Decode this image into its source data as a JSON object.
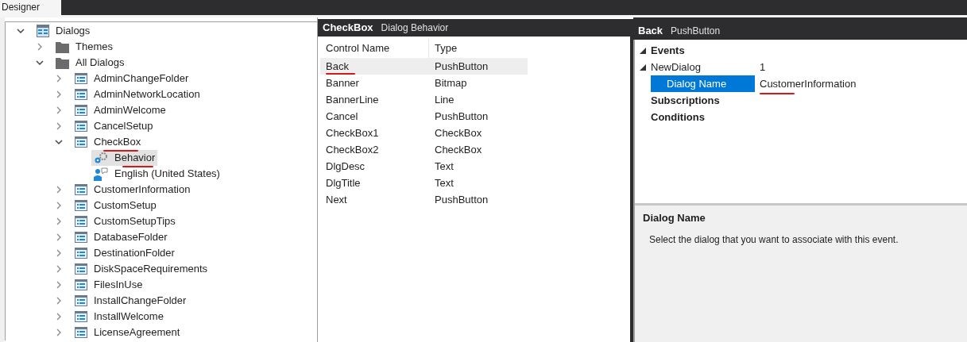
{
  "tabs": [
    {
      "label": "Designer",
      "selected": true
    }
  ],
  "tree": [
    {
      "label": "Dialogs",
      "kind": "dialogs",
      "expanded": true,
      "selected": false,
      "underlined": false,
      "children": [
        {
          "label": "Themes",
          "kind": "folder",
          "expanded": false,
          "selected": false,
          "underlined": false
        },
        {
          "label": "All Dialogs",
          "kind": "folder",
          "expanded": true,
          "selected": false,
          "underlined": false,
          "children": [
            {
              "label": "AdminChangeFolder",
              "kind": "dialog",
              "expanded": false,
              "selected": false,
              "underlined": false
            },
            {
              "label": "AdminNetworkLocation",
              "kind": "dialog",
              "expanded": false,
              "selected": false,
              "underlined": false
            },
            {
              "label": "AdminWelcome",
              "kind": "dialog",
              "expanded": false,
              "selected": false,
              "underlined": false
            },
            {
              "label": "CancelSetup",
              "kind": "dialog",
              "expanded": false,
              "selected": false,
              "underlined": false
            },
            {
              "label": "CheckBox",
              "kind": "dialog",
              "expanded": true,
              "selected": false,
              "underlined": true,
              "children": [
                {
                  "label": "Behavior",
                  "kind": "behavior",
                  "selected": true,
                  "underlined": true
                },
                {
                  "label": "English (United States)",
                  "kind": "language",
                  "selected": false,
                  "underlined": false
                }
              ]
            },
            {
              "label": "CustomerInformation",
              "kind": "dialog",
              "expanded": false,
              "selected": false,
              "underlined": false
            },
            {
              "label": "CustomSetup",
              "kind": "dialog",
              "expanded": false,
              "selected": false,
              "underlined": false
            },
            {
              "label": "CustomSetupTips",
              "kind": "dialog",
              "expanded": false,
              "selected": false,
              "underlined": false
            },
            {
              "label": "DatabaseFolder",
              "kind": "dialog",
              "expanded": false,
              "selected": false,
              "underlined": false
            },
            {
              "label": "DestinationFolder",
              "kind": "dialog",
              "expanded": false,
              "selected": false,
              "underlined": false
            },
            {
              "label": "DiskSpaceRequirements",
              "kind": "dialog",
              "expanded": false,
              "selected": false,
              "underlined": false
            },
            {
              "label": "FilesInUse",
              "kind": "dialog",
              "expanded": false,
              "selected": false,
              "underlined": false
            },
            {
              "label": "InstallChangeFolder",
              "kind": "dialog",
              "expanded": false,
              "selected": false,
              "underlined": false
            },
            {
              "label": "InstallWelcome",
              "kind": "dialog",
              "expanded": false,
              "selected": false,
              "underlined": false
            },
            {
              "label": "LicenseAgreement",
              "kind": "dialog",
              "expanded": false,
              "selected": false,
              "underlined": false
            }
          ]
        }
      ]
    }
  ],
  "controls_panel": {
    "title": "CheckBox",
    "subtitle": "Dialog Behavior",
    "columns": [
      "Control Name",
      "Type"
    ],
    "rows": [
      {
        "name": "Back",
        "type": "PushButton",
        "selected": true,
        "underlined": true
      },
      {
        "name": "Banner",
        "type": "Bitmap",
        "selected": false,
        "underlined": false
      },
      {
        "name": "BannerLine",
        "type": "Line",
        "selected": false,
        "underlined": false
      },
      {
        "name": "Cancel",
        "type": "PushButton",
        "selected": false,
        "underlined": false
      },
      {
        "name": "CheckBox1",
        "type": "CheckBox",
        "selected": false,
        "underlined": false
      },
      {
        "name": "CheckBox2",
        "type": "CheckBox",
        "selected": false,
        "underlined": false
      },
      {
        "name": "DlgDesc",
        "type": "Text",
        "selected": false,
        "underlined": false
      },
      {
        "name": "DlgTitle",
        "type": "Text",
        "selected": false,
        "underlined": false
      },
      {
        "name": "Next",
        "type": "PushButton",
        "selected": false,
        "underlined": false
      }
    ]
  },
  "properties_panel": {
    "title": "Back",
    "subtitle": "PushButton",
    "rows": [
      {
        "kind": "group",
        "label": "Events",
        "expanded": true
      },
      {
        "kind": "event",
        "label": "NewDialog",
        "value": "1",
        "expanded": true
      },
      {
        "kind": "argument",
        "label": "Dialog Name",
        "value": "CustomerInformation",
        "selected": true,
        "underlined": true
      },
      {
        "kind": "group",
        "label": "Subscriptions"
      },
      {
        "kind": "group",
        "label": "Conditions"
      }
    ],
    "help": {
      "title": "Dialog Name",
      "text": "Select the dialog that you want to associate with this event."
    }
  }
}
